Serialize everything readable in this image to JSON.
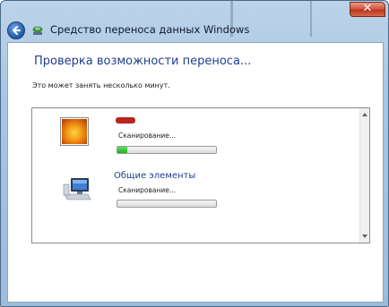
{
  "window": {
    "title": "Средство переноса данных Windows",
    "close_glyph": "✕"
  },
  "main": {
    "heading": "Проверка возможности переноса...",
    "subtext": "Это может занять несколько минут."
  },
  "items": [
    {
      "name": "",
      "status": "Сканирование...",
      "progress": 0.1,
      "icon": "user-picture-flower-icon"
    },
    {
      "name": "Общие элементы",
      "status": "Сканирование...",
      "progress": 0,
      "icon": "computer-icon"
    }
  ],
  "colors": {
    "accent_text": "#1e3f8f",
    "progress_fill": "#1fae1f",
    "close_button": "#c8452a"
  }
}
